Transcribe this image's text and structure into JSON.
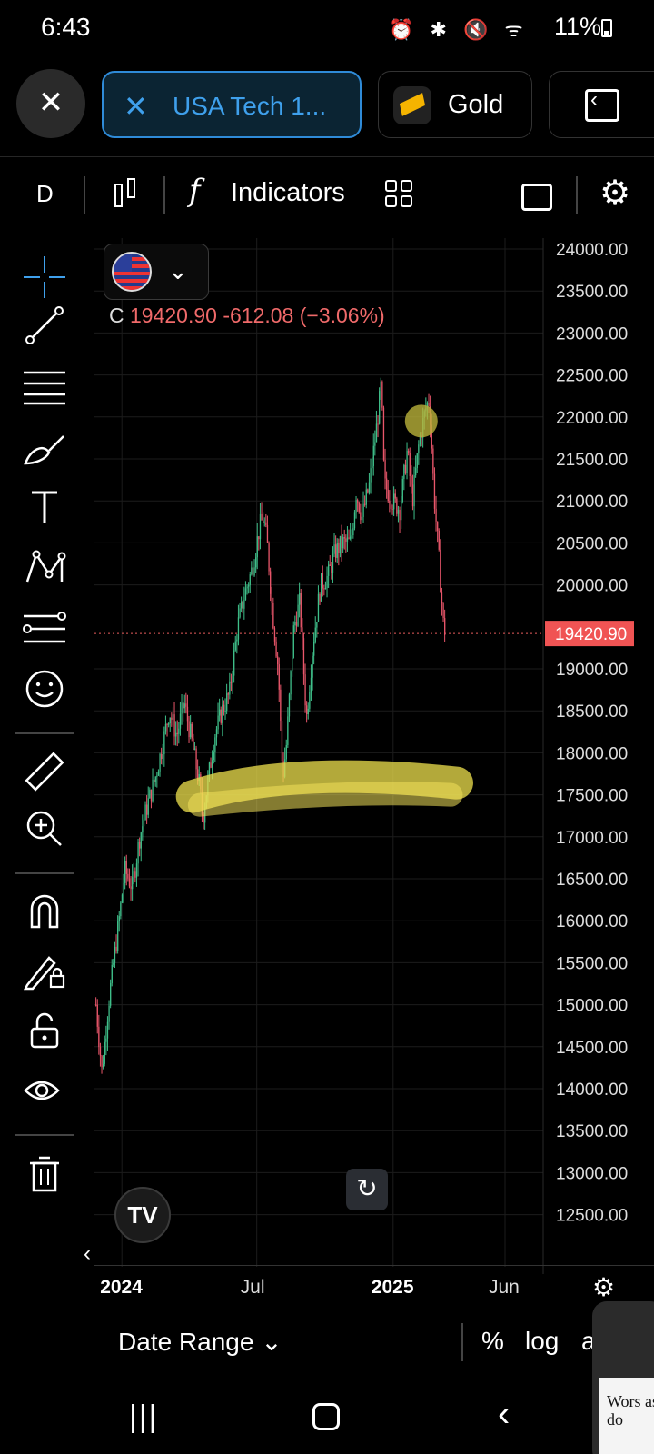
{
  "status": {
    "time": "6:43",
    "icons": "⏰ ✱ 🔇 ᯤ",
    "battery": "11%"
  },
  "tabs": {
    "close_icon": "✕",
    "active": {
      "close_icon": "✕",
      "label": "USA Tech 1..."
    },
    "gold": {
      "label": "Gold",
      "icon": "gold-bar-icon"
    }
  },
  "toolbar": {
    "interval": "D",
    "fx": "f",
    "indicators_label": "Indicators"
  },
  "left_tools": [
    "crosshair-icon",
    "trend-line-icon",
    "fib-icon",
    "brush-icon",
    "text-icon",
    "pattern-icon",
    "forecast-icon",
    "emoji-icon",
    "ruler-icon",
    "zoom-in-icon",
    "magnet-icon",
    "lock-drawing-icon",
    "unlock-icon",
    "eye-icon",
    "trash-icon"
  ],
  "symbol": {
    "close_prefix": "C",
    "close": "19420.90",
    "change": "-612.08 (−3.06%)"
  },
  "chart_data": {
    "type": "candlestick",
    "symbol": "USA Tech 100",
    "interval": "D",
    "price_label": "19420.90",
    "y_ticks": [
      "24000.00",
      "23500.00",
      "23000.00",
      "22500.00",
      "22000.00",
      "21500.00",
      "21000.00",
      "20500.00",
      "20000.00",
      "19000.00",
      "18500.00",
      "18000.00",
      "17500.00",
      "17000.00",
      "16500.00",
      "16000.00",
      "15500.00",
      "15000.00",
      "14500.00",
      "14000.00",
      "13500.00",
      "13000.00",
      "12500.00"
    ],
    "x_ticks": [
      {
        "label": "2024",
        "bold": true
      },
      {
        "label": "Jul",
        "bold": false
      },
      {
        "label": "2025",
        "bold": true
      },
      {
        "label": "Jun",
        "bold": false
      }
    ],
    "path_points": [
      [
        "2023-11-27",
        15000
      ],
      [
        "2023-12-05",
        14200
      ],
      [
        "2023-12-15",
        15100
      ],
      [
        "2023-12-28",
        16000
      ],
      [
        "2024-01-05",
        16600
      ],
      [
        "2024-01-15",
        16400
      ],
      [
        "2024-01-25",
        17000
      ],
      [
        "2024-02-05",
        17400
      ],
      [
        "2024-02-15",
        17700
      ],
      [
        "2024-02-25",
        18100
      ],
      [
        "2024-03-05",
        18500
      ],
      [
        "2024-03-15",
        18200
      ],
      [
        "2024-03-25",
        18600
      ],
      [
        "2024-04-05",
        18100
      ],
      [
        "2024-04-15",
        17600
      ],
      [
        "2024-04-19",
        17200
      ],
      [
        "2024-04-25",
        17600
      ],
      [
        "2024-05-05",
        18200
      ],
      [
        "2024-05-15",
        18500
      ],
      [
        "2024-05-25",
        18700
      ],
      [
        "2024-06-05",
        19500
      ],
      [
        "2024-06-15",
        19900
      ],
      [
        "2024-06-25",
        20200
      ],
      [
        "2024-07-05",
        20700
      ],
      [
        "2024-07-10",
        20800
      ],
      [
        "2024-07-15",
        20500
      ],
      [
        "2024-07-22",
        19700
      ],
      [
        "2024-07-30",
        19000
      ],
      [
        "2024-08-05",
        17700
      ],
      [
        "2024-08-10",
        18100
      ],
      [
        "2024-08-20",
        19500
      ],
      [
        "2024-08-28",
        19800
      ],
      [
        "2024-09-06",
        18400
      ],
      [
        "2024-09-15",
        19300
      ],
      [
        "2024-09-25",
        20000
      ],
      [
        "2024-10-05",
        20100
      ],
      [
        "2024-10-15",
        20400
      ],
      [
        "2024-10-25",
        20500
      ],
      [
        "2024-11-05",
        20500
      ],
      [
        "2024-11-12",
        21100
      ],
      [
        "2024-11-20",
        20800
      ],
      [
        "2024-11-30",
        21200
      ],
      [
        "2024-12-10",
        21900
      ],
      [
        "2024-12-16",
        22400
      ],
      [
        "2024-12-20",
        21200
      ],
      [
        "2024-12-31",
        21000
      ],
      [
        "2025-01-10",
        20900
      ],
      [
        "2025-01-20",
        21600
      ],
      [
        "2025-01-27",
        21000
      ],
      [
        "2025-02-05",
        21700
      ],
      [
        "2025-02-14",
        22100
      ],
      [
        "2025-02-19",
        22200
      ],
      [
        "2025-02-25",
        21100
      ],
      [
        "2025-03-03",
        20400
      ],
      [
        "2025-03-10",
        19500
      ],
      [
        "2025-03-13",
        19420.9
      ]
    ],
    "grid": true,
    "highlights": [
      "support-zone-around-17500",
      "marker-circle-near-22000"
    ]
  },
  "bottom": {
    "date_range": "Date Range",
    "chevron": "⌄",
    "percent": "%",
    "log": "log",
    "auto": "a"
  },
  "pip": {
    "headline": "Wors as do"
  },
  "nav": {
    "recent": "|||",
    "back": "‹"
  }
}
